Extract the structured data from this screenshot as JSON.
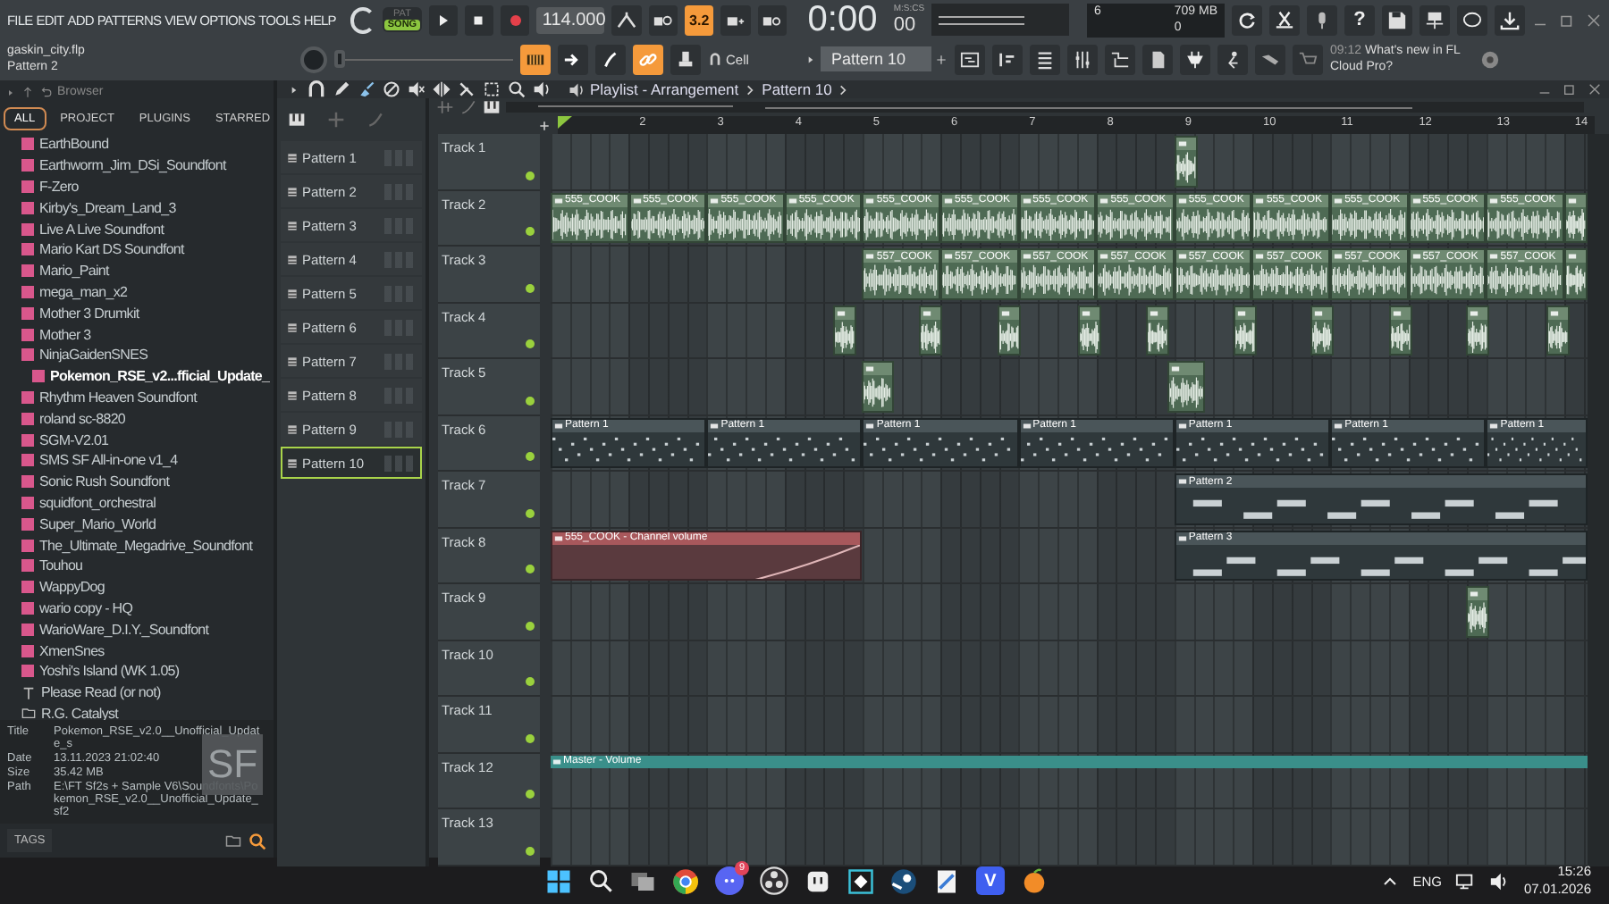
{
  "menu": [
    "FILE",
    "EDIT",
    "ADD",
    "PATTERNS",
    "VIEW",
    "OPTIONS",
    "TOOLS",
    "HELP"
  ],
  "project": {
    "file": "gaskin_city.flp",
    "pattern": "Pattern 2"
  },
  "transport": {
    "pat_label": "PAT",
    "song_label": "SONG",
    "song_mode": true,
    "tempo": "114.000",
    "time": "0:00",
    "time_format": "M:S:CS",
    "centiseconds": "00"
  },
  "top_tools": [
    {
      "kind": "fork",
      "on": false
    },
    {
      "kind": "typing",
      "on": false
    },
    {
      "kind": "countdown",
      "label": "3.2",
      "on": true
    },
    {
      "kind": "step",
      "on": false
    },
    {
      "kind": "loop",
      "on": false
    }
  ],
  "monitor": {
    "cpu": "6",
    "memory": "709 MB",
    "voices": "0"
  },
  "help_label": "?",
  "master_pitch": {
    "level": 0
  },
  "snap_tools": [
    {
      "kind": "keys",
      "on": true
    },
    {
      "kind": "arrow",
      "on": false
    },
    {
      "kind": "slash",
      "on": false
    },
    {
      "kind": "link",
      "on": true
    },
    {
      "kind": "stamp",
      "on": false
    }
  ],
  "snap": "Cell",
  "pattern_selector": "Pattern 10",
  "news": {
    "time": "09:12",
    "text": "What's new in FL Cloud Pro?"
  },
  "browser": {
    "title": "Browser",
    "tabs": [
      {
        "label": "ALL",
        "selected": true
      },
      {
        "label": "PROJECT",
        "selected": false
      },
      {
        "label": "PLUGINS",
        "selected": false
      },
      {
        "label": "STARRED",
        "selected": false
      }
    ],
    "items": [
      {
        "kind": "soundfont",
        "label": "EarthBound",
        "selected": false
      },
      {
        "kind": "soundfont",
        "label": "Earthworm_Jim_DSi_Soundfont",
        "selected": false
      },
      {
        "kind": "soundfont",
        "label": "F-Zero",
        "selected": false
      },
      {
        "kind": "soundfont",
        "label": "Kirby's_Dream_Land_3",
        "selected": false
      },
      {
        "kind": "soundfont",
        "label": "Live A Live Soundfont",
        "selected": false
      },
      {
        "kind": "soundfont",
        "label": "Mario Kart DS Soundfont",
        "selected": false
      },
      {
        "kind": "soundfont",
        "label": "Mario_Paint",
        "selected": false
      },
      {
        "kind": "soundfont",
        "label": "mega_man_x2",
        "selected": false
      },
      {
        "kind": "soundfont",
        "label": "Mother 3 Drumkit",
        "selected": false
      },
      {
        "kind": "soundfont",
        "label": "Mother 3",
        "selected": false
      },
      {
        "kind": "soundfont",
        "label": "NinjaGaidenSNES",
        "selected": false,
        "children": [
          {
            "kind": "soundfont",
            "label": "Pokemon_RSE_v2...fficial_Update_",
            "selected": true
          }
        ]
      },
      {
        "kind": "soundfont",
        "label": "Rhythm Heaven Soundfont",
        "selected": false
      },
      {
        "kind": "soundfont",
        "label": "roland sc-8820",
        "selected": false
      },
      {
        "kind": "soundfont",
        "label": "SGM-V2.01",
        "selected": false
      },
      {
        "kind": "soundfont",
        "label": "SMS SF All-in-one v1_4",
        "selected": false
      },
      {
        "kind": "soundfont",
        "label": "Sonic Rush Soundfont",
        "selected": false
      },
      {
        "kind": "soundfont",
        "label": "squidfont_orchestral",
        "selected": false
      },
      {
        "kind": "soundfont",
        "label": "Super_Mario_World",
        "selected": false
      },
      {
        "kind": "soundfont",
        "label": "The_Ultimate_Megadrive_Soundfont",
        "selected": false
      },
      {
        "kind": "soundfont",
        "label": "Touhou",
        "selected": false
      },
      {
        "kind": "soundfont",
        "label": "WappyDog",
        "selected": false
      },
      {
        "kind": "soundfont",
        "label": "wario copy - HQ",
        "selected": false
      },
      {
        "kind": "soundfont",
        "label": "WarioWare_D.I.Y._Soundfont",
        "selected": false
      },
      {
        "kind": "soundfont",
        "label": "XmenSnes",
        "selected": false
      },
      {
        "kind": "soundfont",
        "label": "Yoshi's Island (WK 1.05)",
        "selected": false
      },
      {
        "kind": "text",
        "label": "Please Read (or not)",
        "selected": false
      },
      {
        "kind": "folder",
        "label": "R.G. Catalyst",
        "selected": false
      }
    ],
    "info": [
      {
        "key": "Title",
        "value": "Pokemon_RSE_v2.0__Unofficial_Update_s"
      },
      {
        "key": "Date",
        "value": "13.11.2023 21:02:40"
      },
      {
        "key": "Size",
        "value": "35.42 MB"
      },
      {
        "key": "Path",
        "value": "E:\\FT Sf2s + Sample V6\\Soundfonts\\Pokemon_RSE_v2.0__Unofficial_Update_sf2"
      }
    ],
    "badge": "SF",
    "tags": "TAGS"
  },
  "patterns": [
    {
      "name": "Pattern 1",
      "selected": false
    },
    {
      "name": "Pattern 2",
      "selected": false
    },
    {
      "name": "Pattern 3",
      "selected": false
    },
    {
      "name": "Pattern 4",
      "selected": false
    },
    {
      "name": "Pattern 5",
      "selected": false
    },
    {
      "name": "Pattern 6",
      "selected": false
    },
    {
      "name": "Pattern 7",
      "selected": false
    },
    {
      "name": "Pattern 8",
      "selected": false
    },
    {
      "name": "Pattern 9",
      "selected": false
    },
    {
      "name": "Pattern 10",
      "selected": true
    }
  ],
  "playlist": {
    "title": "Playlist - Arrangement",
    "pattern": "Pattern 10",
    "ruler": [
      "2",
      "3",
      "4",
      "5",
      "6",
      "7",
      "8",
      "9",
      "10",
      "11",
      "12",
      "13",
      "14"
    ],
    "tracks": [
      {
        "name": "Track 1",
        "clips": [
          {
            "kind": "audio",
            "color": "#6f8a72"
          }
        ]
      },
      {
        "name": "Track 2",
        "clips": [
          {
            "kind": "audio",
            "label": "555_COOK",
            "color": "#6f8a72"
          },
          {
            "kind": "audio",
            "label": "555_COOK",
            "color": "#6f8a72"
          },
          {
            "kind": "audio",
            "label": "555_COOK",
            "color": "#6f8a72"
          },
          {
            "kind": "audio",
            "label": "555_COOK",
            "color": "#6f8a72"
          },
          {
            "kind": "audio",
            "label": "555_COOK",
            "color": "#6f8a72"
          },
          {
            "kind": "audio",
            "label": "555_COOK",
            "color": "#6f8a72"
          },
          {
            "kind": "audio",
            "label": "555_COOK",
            "color": "#6f8a72"
          },
          {
            "kind": "audio",
            "label": "555_COOK",
            "color": "#6f8a72"
          },
          {
            "kind": "audio",
            "label": "555_COOK",
            "color": "#6f8a72"
          },
          {
            "kind": "audio",
            "label": "555_COOK",
            "color": "#6f8a72"
          },
          {
            "kind": "audio",
            "label": "555_COOK",
            "color": "#6f8a72"
          },
          {
            "kind": "audio",
            "label": "555_COOK",
            "color": "#6f8a72"
          },
          {
            "kind": "audio",
            "label": "555_COOK",
            "color": "#6f8a72"
          },
          {
            "kind": "audio",
            "color": "#6f8a72"
          }
        ]
      },
      {
        "name": "Track 3",
        "clips": [
          {
            "kind": "audio",
            "label": "557_COOK",
            "color": "#6f8a72"
          },
          {
            "kind": "audio",
            "label": "557_COOK",
            "color": "#6f8a72"
          },
          {
            "kind": "audio",
            "label": "557_COOK",
            "color": "#6f8a72"
          },
          {
            "kind": "audio",
            "label": "557_COOK",
            "color": "#6f8a72"
          },
          {
            "kind": "audio",
            "label": "557_COOK",
            "color": "#6f8a72"
          },
          {
            "kind": "audio",
            "label": "557_COOK",
            "color": "#6f8a72"
          },
          {
            "kind": "audio",
            "label": "557_COOK",
            "color": "#6f8a72"
          },
          {
            "kind": "audio",
            "label": "557_COOK",
            "color": "#6f8a72"
          },
          {
            "kind": "audio",
            "label": "557_COOK",
            "color": "#6f8a72"
          },
          {
            "kind": "audio",
            "color": "#6f8a72"
          }
        ]
      },
      {
        "name": "Track 4",
        "clips": [
          {
            "kind": "audio",
            "color": "#6f8a72"
          },
          {
            "kind": "audio",
            "color": "#6f8a72"
          },
          {
            "kind": "audio",
            "color": "#6f8a72"
          },
          {
            "kind": "audio",
            "color": "#6f8a72"
          },
          {
            "kind": "audio",
            "color": "#6f8a72"
          },
          {
            "kind": "audio",
            "color": "#6f8a72"
          },
          {
            "kind": "audio",
            "color": "#6f8a72"
          },
          {
            "kind": "audio",
            "color": "#6f8a72"
          },
          {
            "kind": "audio",
            "color": "#6f8a72"
          },
          {
            "kind": "audio",
            "color": "#6f8a72"
          }
        ]
      },
      {
        "name": "Track 5",
        "clips": [
          {
            "kind": "audio",
            "color": "#6f8a72"
          },
          {
            "kind": "audio",
            "color": "#6f8a72"
          }
        ]
      },
      {
        "name": "Track 6",
        "clips": [
          {
            "kind": "pattern",
            "label": "Pattern 1",
            "color": "#4a5559"
          },
          {
            "kind": "pattern",
            "label": "Pattern 1",
            "color": "#4a5559"
          },
          {
            "kind": "pattern",
            "label": "Pattern 1",
            "color": "#4a5559"
          },
          {
            "kind": "pattern",
            "label": "Pattern 1",
            "color": "#4a5559"
          },
          {
            "kind": "pattern",
            "label": "Pattern 1",
            "color": "#4a5559"
          },
          {
            "kind": "pattern",
            "label": "Pattern 1",
            "color": "#4a5559"
          },
          {
            "kind": "pattern",
            "label": "Pattern 1",
            "color": "#4a5559"
          }
        ]
      },
      {
        "name": "Track 7",
        "clips": [
          {
            "kind": "pattern",
            "label": "Pattern 2",
            "color": "#4a5559"
          }
        ]
      },
      {
        "name": "Track 8",
        "clips": [
          {
            "kind": "automation",
            "label": "555_COOK - Channel volume",
            "color": "#a8585c"
          },
          {
            "kind": "pattern",
            "label": "Pattern 3",
            "color": "#4a5559"
          }
        ]
      },
      {
        "name": "Track 9",
        "clips": [
          {
            "kind": "audio",
            "color": "#6f8a72"
          }
        ]
      },
      {
        "name": "Track 10"
      },
      {
        "name": "Track 11"
      },
      {
        "name": "Track 12",
        "clips": [
          {
            "kind": "automation",
            "label": "Master - Volume",
            "color": "#3a8f8a"
          }
        ]
      },
      {
        "name": "Track 13"
      }
    ]
  },
  "taskbar": {
    "discord_badge": "9",
    "v_label": "V",
    "language": "ENG",
    "time": "15:26",
    "date": "07.01.2026"
  }
}
